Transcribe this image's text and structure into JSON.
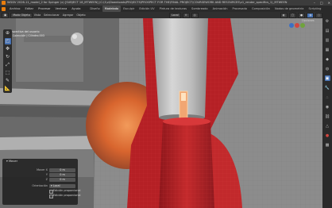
{
  "titlebar": {
    "text": "WGDV 2026-11_model_2 for Spinger (x) [SUBJECT 18_MTWEEN] (C:\\1\\v\\Downloads\\PROJECTS\\PROSPECT FOR THE\\FINAL PROJECT\\COURSEWORK AND RESOURCES\\v1_render_specifics_1)_MTWEEN",
    "minimize": "–",
    "maximize": "□",
    "close": "✕"
  },
  "menubar": {
    "items": [
      "Archivo",
      "Editar",
      "Procesar",
      "Ventana",
      "Ayuda"
    ],
    "workspaces": [
      "Diseño",
      "Modelado",
      "Esculpir",
      "Edición UV",
      "Pintura de texturas",
      "Sombreado",
      "Animación",
      "Procesado",
      "Composición",
      "Nodos de geometría",
      "Scripting"
    ],
    "active_workspace": "Modelado"
  },
  "toolheader": {
    "mode": "Modo Objeto",
    "menus": [
      "Vista",
      "Seleccionar",
      "Agregar",
      "Objeto"
    ],
    "pivot": "Local",
    "options": "Opciones"
  },
  "viewport": {
    "overlay_line1": "Perspectiva del usuario",
    "overlay_line2": "(1) Colección | Cilindro.003"
  },
  "toolbar": {
    "tools": [
      "cursor",
      "select-box",
      "move",
      "rotate",
      "scale",
      "transform",
      "annotate",
      "measure"
    ]
  },
  "right_icons": [
    "view",
    "tool",
    "object",
    "modifier",
    "particles",
    "physics",
    "constraints",
    "data",
    "material",
    "texture",
    "world",
    "render"
  ],
  "operator_panel": {
    "title": "Mover",
    "move_x_label": "Mover X",
    "move_x_value": "0 m",
    "y_label": "Y",
    "y_value": "0 m",
    "z_label": "Z",
    "z_value": "0 m",
    "orientation_label": "Orientación",
    "orientation_value": "Local",
    "checkbox1": "Edición proporcional",
    "checkbox2": "Edición proporcional"
  },
  "colors": {
    "accent": "#4772b3",
    "brand": "#e87d0d",
    "red_object": "#b52025",
    "grey_object": "#c9c9c9"
  }
}
